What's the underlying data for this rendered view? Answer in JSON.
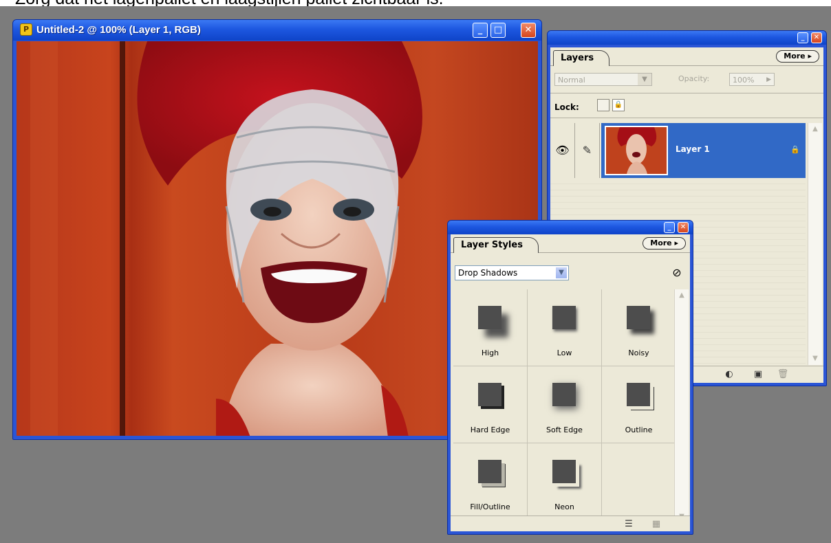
{
  "caption": "Zorg dat het lagenpallet en laagstijlen pallet zichtbaar is.",
  "document_window": {
    "title": "Untitled-2 @ 100% (Layer 1, RGB)",
    "minimize_glyph": "_",
    "maximize_glyph": "□",
    "close_glyph": "✕"
  },
  "layers_palette": {
    "tab": "Layers",
    "more": "More ▸",
    "blend_mode": "Normal",
    "opacity_label": "Opacity:",
    "opacity_value": "100%",
    "lock_label": "Lock:",
    "layer_name": "Layer 1"
  },
  "layer_styles_palette": {
    "tab": "Layer Styles",
    "more": "More ▸",
    "category": "Drop Shadows",
    "styles": [
      "High",
      "Low",
      "Noisy",
      "Hard Edge",
      "Soft Edge",
      "Outline",
      "Fill/Outline",
      "Neon"
    ]
  },
  "colors": {
    "xp_title_blue": "#1d57e0",
    "selection_blue": "#3169c6",
    "palette_bg": "#ece9d8",
    "workspace_gray": "#7c7c7c"
  },
  "icons": [
    "photoshop-doc-icon",
    "eye-icon",
    "brush-icon",
    "lock-icon",
    "no-style-icon",
    "list-view-icon",
    "thumbnail-view-icon",
    "new-layer-icon",
    "trash-icon",
    "adjustment-layer-icon"
  ]
}
